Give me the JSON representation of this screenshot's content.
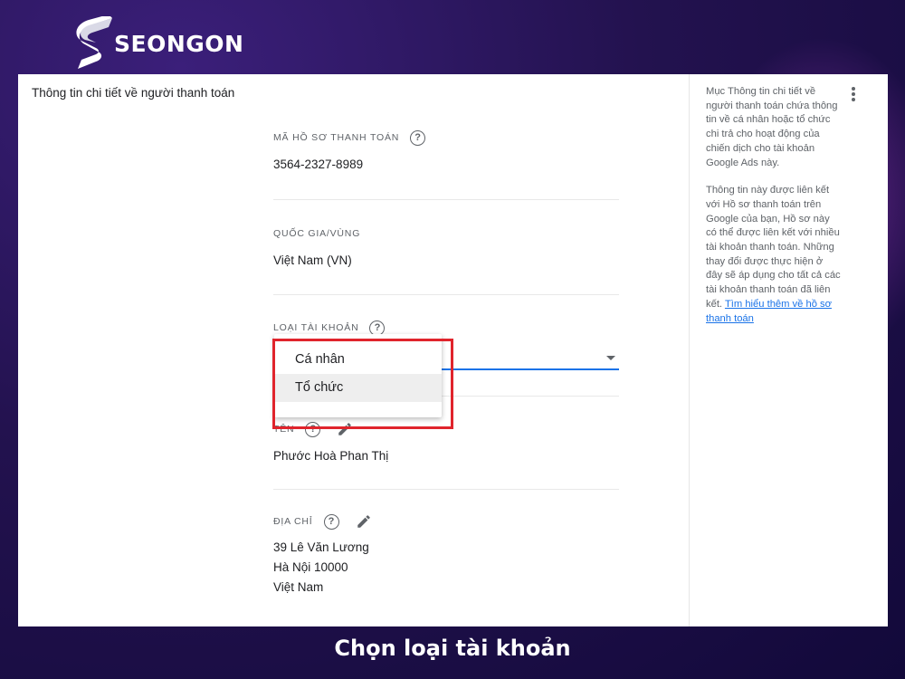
{
  "brand": {
    "name": "SEONGON"
  },
  "section": {
    "title": "Thông tin chi tiết về người thanh toán"
  },
  "fields": {
    "profile_id": {
      "label": "Mã hồ sơ thanh toán",
      "value": "3564-2327-8989"
    },
    "country": {
      "label": "Quốc gia/vùng",
      "value": "Việt Nam (VN)"
    },
    "account_type": {
      "label": "Loại tài khoản"
    },
    "name": {
      "label": "Tên",
      "value": "Phước Hoà Phan Thị"
    },
    "address": {
      "label": "Địa chỉ",
      "lines": [
        "39 Lê Văn Lương",
        "Hà Nội 10000",
        "Việt Nam"
      ]
    }
  },
  "dropdown": {
    "options": [
      "Cá nhân",
      "Tổ chức"
    ],
    "highlighted": "Tổ chức"
  },
  "help": {
    "paragraph1": "Mục Thông tin chi tiết về người thanh toán chứa thông tin về cá nhân hoặc tổ chức chi trả cho hoạt động của chiến dịch cho tài khoản Google Ads này.",
    "paragraph2": "Thông tin này được liên kết với Hồ sơ thanh toán trên Google của bạn, Hồ sơ này có thể được liên kết với nhiều tài khoản thanh toán. Những thay đổi được thực hiện ở đây sẽ áp dụng cho tất cả các tài khoản thanh toán đã liên kết.",
    "link": "Tìm hiểu thêm về hồ sơ thanh toán"
  },
  "caption": "Chọn loại tài khoản",
  "colors": {
    "accent_blue": "#1a73e8",
    "highlight_red": "#e0242c",
    "background_purple": "#23124f"
  }
}
